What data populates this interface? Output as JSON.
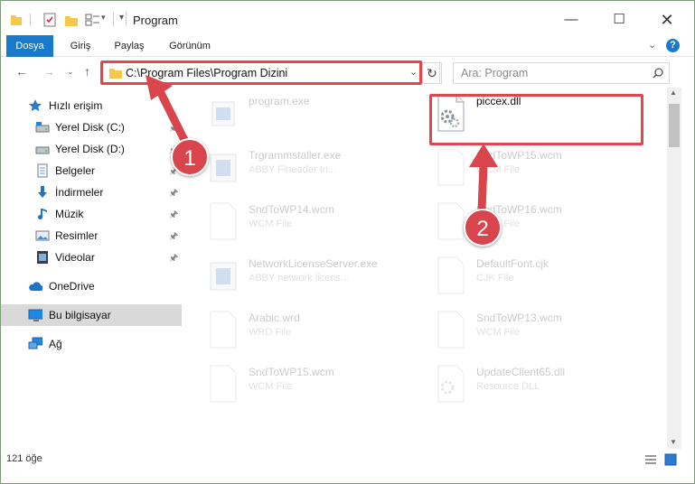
{
  "window": {
    "title": "Program"
  },
  "ribbon": {
    "tabs": [
      "Dosya",
      "Giriş",
      "Paylaş",
      "Görünüm"
    ]
  },
  "nav": {
    "address": "C:\\Program Files\\Program Dizini",
    "search_placeholder": "Ara: Program"
  },
  "sidebar": {
    "quick_access": "Hızlı erişim",
    "items": [
      {
        "label": "Yerel Disk (C:)",
        "icon": "drive-icon"
      },
      {
        "label": "Yerel Disk (D:)",
        "icon": "drive-icon"
      },
      {
        "label": "Belgeler",
        "icon": "documents-icon"
      },
      {
        "label": "İndirmeler",
        "icon": "downloads-icon"
      },
      {
        "label": "Müzik",
        "icon": "music-icon"
      },
      {
        "label": "Resimler",
        "icon": "pictures-icon"
      },
      {
        "label": "Videolar",
        "icon": "videos-icon"
      }
    ],
    "onedrive": "OneDrive",
    "this_pc": "Bu bilgisayar",
    "network": "Ağ"
  },
  "files": [
    {
      "name": "program.exe",
      "type": ""
    },
    {
      "name": "piccex.dll",
      "type": ""
    },
    {
      "name": "Trgrammstaller.exe",
      "type": "ABBY Fineader In..."
    },
    {
      "name": "SndToWP15.wcm",
      "type": "WCM File"
    },
    {
      "name": "SndToWP14.wcm",
      "type": "WCM File"
    },
    {
      "name": "SndToWP16.wcm",
      "type": "WCM File"
    },
    {
      "name": "NetworkLicenseServer.exe",
      "type": "ABBY network licens..."
    },
    {
      "name": "DefaultFont.cjk",
      "type": "CJK File"
    },
    {
      "name": "Arabic.wrd",
      "type": "WRD File"
    },
    {
      "name": "SndToWP13.wcm",
      "type": "WCM File"
    },
    {
      "name": "SndToWP15.wcm",
      "type": "WCM File"
    },
    {
      "name": "UpdateClient65.dll",
      "type": "Resource DLL"
    }
  ],
  "status": {
    "count": "121 öğe"
  },
  "callouts": [
    "1",
    "2"
  ],
  "colors": {
    "accent": "#1979ca",
    "highlight": "#e0464e",
    "badge": "#d9454c"
  }
}
